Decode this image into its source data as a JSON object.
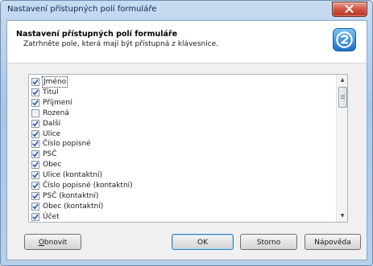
{
  "window": {
    "title": "Nastavení přístupných polí formuláře"
  },
  "header": {
    "title": "Nastavení přístupných polí formuláře",
    "subtitle": "Zatrhněte pole, která mají být přístupná z klávesnice."
  },
  "fields": [
    {
      "label": "Jméno",
      "checked": true,
      "focused": true
    },
    {
      "label": "Titul",
      "checked": true
    },
    {
      "label": "Příjmení",
      "checked": true
    },
    {
      "label": "Rozená",
      "checked": false
    },
    {
      "label": "Další",
      "checked": true
    },
    {
      "label": "Ulice",
      "checked": true
    },
    {
      "label": "Číslo popisné",
      "checked": true
    },
    {
      "label": "PSČ",
      "checked": true
    },
    {
      "label": "Obec",
      "checked": true
    },
    {
      "label": "Ulice (kontaktní)",
      "checked": true
    },
    {
      "label": "Číslo popisné (kontaktní)",
      "checked": true
    },
    {
      "label": "PSČ (kontaktní)",
      "checked": true
    },
    {
      "label": "Obec (kontaktní)",
      "checked": true
    },
    {
      "label": "Účet",
      "checked": true
    }
  ],
  "buttons": {
    "refresh": {
      "mnemonic": "O",
      "rest": "bnovit"
    },
    "ok": "OK",
    "cancel": "Storno",
    "help": "Nápověda"
  },
  "icons": {
    "close": "close-x-icon",
    "logo": "app-logo-icon",
    "check": "checkmark-icon",
    "scroll_up": "scroll-up-arrow-icon",
    "scroll_down": "scroll-down-arrow-icon"
  },
  "colors": {
    "accent": "#2a7fd0",
    "close": "#c8432c",
    "check": "#2b4fa0"
  }
}
